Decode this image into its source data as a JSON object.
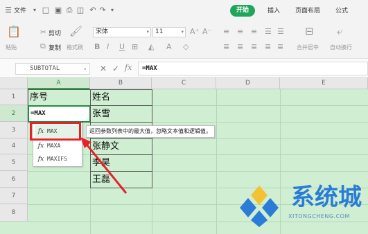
{
  "menubar": {
    "menu_file": "文件",
    "tabs": [
      "开始",
      "插入",
      "页面布局",
      "公式"
    ],
    "active_tab_color": "#1fa65a"
  },
  "ribbon": {
    "paste_label": "粘贴",
    "cut_label": "剪切",
    "copy_label": "复制",
    "format_painter_label": "格式刷",
    "font_name": "宋体",
    "font_size": "11",
    "merge_center_label": "合并居中",
    "auto_wrap_label": "自动换行",
    "font_grow": "A⁺",
    "font_shrink": "A⁻"
  },
  "formula_bar": {
    "name_box": "SUBTOTAL",
    "fx_symbol": "fx",
    "formula": "=MAX"
  },
  "sheet": {
    "columns": [
      "A",
      "B",
      "C",
      "D",
      "E"
    ],
    "rows": [
      "1",
      "2",
      "3",
      "4",
      "5",
      "6",
      "7",
      "8"
    ],
    "cells": {
      "A1": "序号",
      "B1": "姓名",
      "A2": "=MAX",
      "B2": "张雪",
      "B4": "张静文",
      "B5": "李昊",
      "B6": "王磊"
    },
    "background_color": "#cfeed2"
  },
  "autocomplete": {
    "items": [
      "MAX",
      "MAXA",
      "MAXIFS"
    ],
    "highlight_color": "#e8202a",
    "tooltip": "返回参数列表中的最大值，忽略文本值和逻辑值。"
  },
  "watermark": {
    "title": "系统城",
    "url": "XITONGCHENG.COM"
  }
}
